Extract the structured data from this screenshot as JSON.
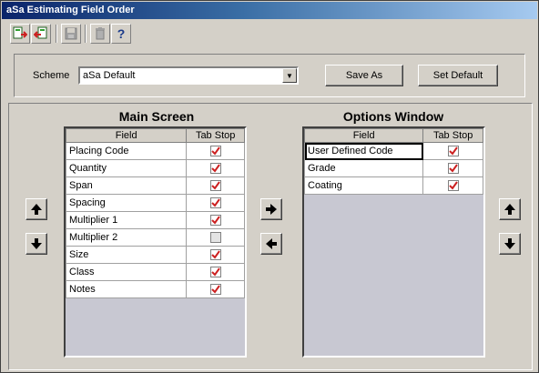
{
  "window": {
    "title": "aSa Estimating Field Order"
  },
  "toolbar": {
    "buttons": [
      {
        "icon": "import-icon"
      },
      {
        "icon": "export-icon"
      },
      {
        "icon": "save-icon"
      },
      {
        "icon": "delete-icon"
      },
      {
        "icon": "help-icon",
        "glyph": "?"
      }
    ]
  },
  "scheme": {
    "label": "Scheme",
    "value": "aSa Default"
  },
  "buttons": {
    "save_as": "Save As",
    "set_default": "Set Default"
  },
  "main_screen": {
    "title": "Main Screen",
    "col_field": "Field",
    "col_tab": "Tab Stop",
    "rows": [
      {
        "field": "Placing Code",
        "checked": true
      },
      {
        "field": "Quantity",
        "checked": true
      },
      {
        "field": "Span",
        "checked": true
      },
      {
        "field": "Spacing",
        "checked": true
      },
      {
        "field": "Multiplier 1",
        "checked": true
      },
      {
        "field": "Multiplier 2",
        "checked": false
      },
      {
        "field": "Size",
        "checked": true
      },
      {
        "field": "Class",
        "checked": true
      },
      {
        "field": "Notes",
        "checked": true
      }
    ]
  },
  "options_window": {
    "title": "Options Window",
    "col_field": "Field",
    "col_tab": "Tab Stop",
    "rows": [
      {
        "field": "User Defined Code",
        "checked": true,
        "selected": true
      },
      {
        "field": "Grade",
        "checked": true
      },
      {
        "field": "Coating",
        "checked": true
      }
    ]
  },
  "colors": {
    "title_start": "#0a246a",
    "title_end": "#a6caf0",
    "check": "#cc2020",
    "face": "#d4d0c8"
  }
}
